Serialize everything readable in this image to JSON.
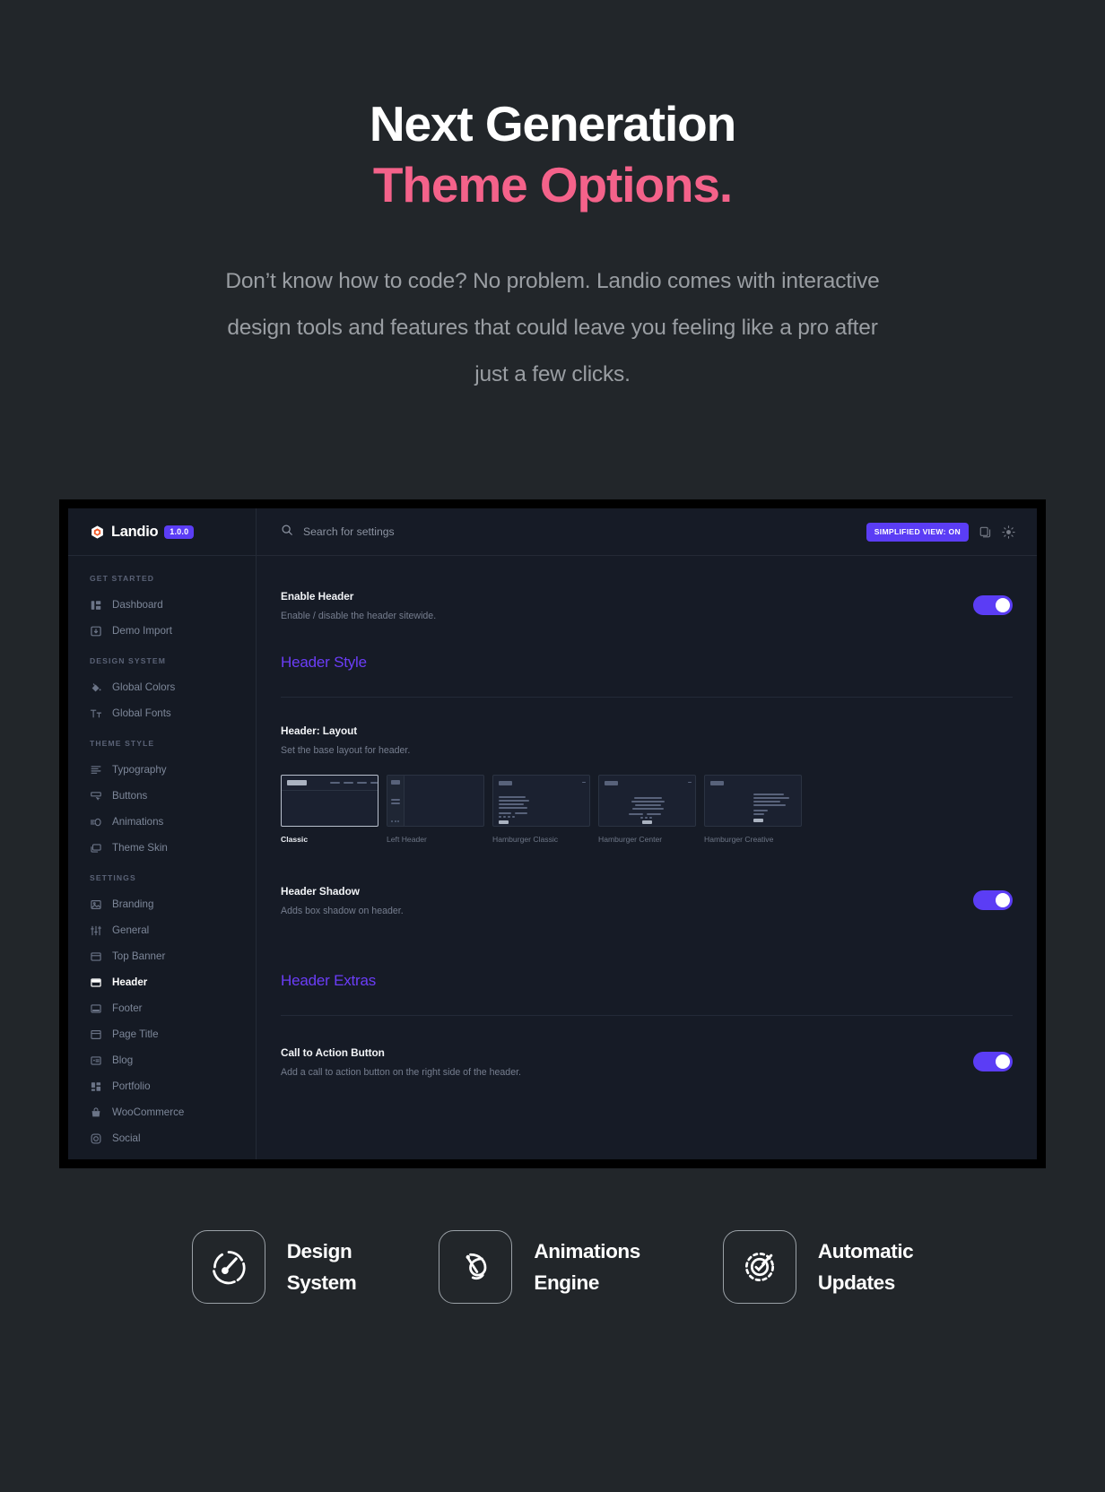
{
  "hero": {
    "title_line1": "Next Generation",
    "title_line2": "Theme Options.",
    "accent_color": "#f4628a",
    "subtitle": "Don’t know how to code? No problem. Landio comes with interactive design tools and features that could leave you feeling like a pro after just a few clicks."
  },
  "app": {
    "brand": {
      "name": "Landio",
      "version": "1.0.0",
      "logo_icon": "cube-logo-icon"
    },
    "sidebar": {
      "groups": [
        {
          "label": "GET STARTED",
          "items": [
            {
              "label": "Dashboard",
              "icon": "dashboard-icon",
              "active": false
            },
            {
              "label": "Demo Import",
              "icon": "demo-import-icon",
              "active": false
            }
          ]
        },
        {
          "label": "DESIGN SYSTEM",
          "items": [
            {
              "label": "Global Colors",
              "icon": "paint-bucket-icon",
              "active": false
            },
            {
              "label": "Global Fonts",
              "icon": "typography-tt-icon",
              "active": false
            }
          ]
        },
        {
          "label": "THEME STYLE",
          "items": [
            {
              "label": "Typography",
              "icon": "text-lines-icon",
              "active": false
            },
            {
              "label": "Buttons",
              "icon": "button-icon",
              "active": false
            },
            {
              "label": "Animations",
              "icon": "animations-icon",
              "active": false
            },
            {
              "label": "Theme Skin",
              "icon": "layers-icon",
              "active": false
            }
          ]
        },
        {
          "label": "SETTINGS",
          "items": [
            {
              "label": "Branding",
              "icon": "image-icon",
              "active": false
            },
            {
              "label": "General",
              "icon": "sliders-icon",
              "active": false
            },
            {
              "label": "Top Banner",
              "icon": "top-banner-icon",
              "active": false
            },
            {
              "label": "Header",
              "icon": "header-icon",
              "active": true
            },
            {
              "label": "Footer",
              "icon": "footer-icon",
              "active": false
            },
            {
              "label": "Page Title",
              "icon": "page-title-icon",
              "active": false
            },
            {
              "label": "Blog",
              "icon": "blog-icon",
              "active": false
            },
            {
              "label": "Portfolio",
              "icon": "portfolio-icon",
              "active": false
            },
            {
              "label": "WooCommerce",
              "icon": "shopping-bag-icon",
              "active": false
            },
            {
              "label": "Social",
              "icon": "instagram-icon",
              "active": false
            }
          ]
        }
      ]
    },
    "topbar": {
      "search_placeholder": "Search for settings",
      "search_value": "",
      "search_icon": "search-icon",
      "simplified_view_label": "SIMPLIFIED VIEW: ON",
      "copy_icon": "copy-icon",
      "brightness_icon": "brightness-icon",
      "accent_color": "#5b3df5"
    },
    "settings": {
      "enable_header": {
        "title": "Enable Header",
        "desc": "Enable / disable the header sitewide.",
        "toggle_state": "on"
      },
      "header_style_section": "Header Style",
      "header_layout": {
        "title": "Header: Layout",
        "desc": "Set the base layout for header.",
        "options": [
          {
            "label": "Classic",
            "selected": true
          },
          {
            "label": "Left Header",
            "selected": false
          },
          {
            "label": "Hamburger Classic",
            "selected": false
          },
          {
            "label": "Hamburger Center",
            "selected": false
          },
          {
            "label": "Hamburger Creative",
            "selected": false
          }
        ]
      },
      "header_shadow": {
        "title": "Header Shadow",
        "desc": "Adds box shadow on header.",
        "toggle_state": "on"
      },
      "header_extras_section": "Header Extras",
      "call_to_action": {
        "title": "Call to Action Button",
        "desc": "Add a call to action button on the right side of the header.",
        "toggle_state": "on"
      }
    }
  },
  "features": [
    {
      "icon": "design-system-icon",
      "label": "Design\nSystem"
    },
    {
      "icon": "animations-engine-icon",
      "label": "Animations\nEngine"
    },
    {
      "icon": "automatic-updates-icon",
      "label": "Automatic\nUpdates"
    }
  ]
}
